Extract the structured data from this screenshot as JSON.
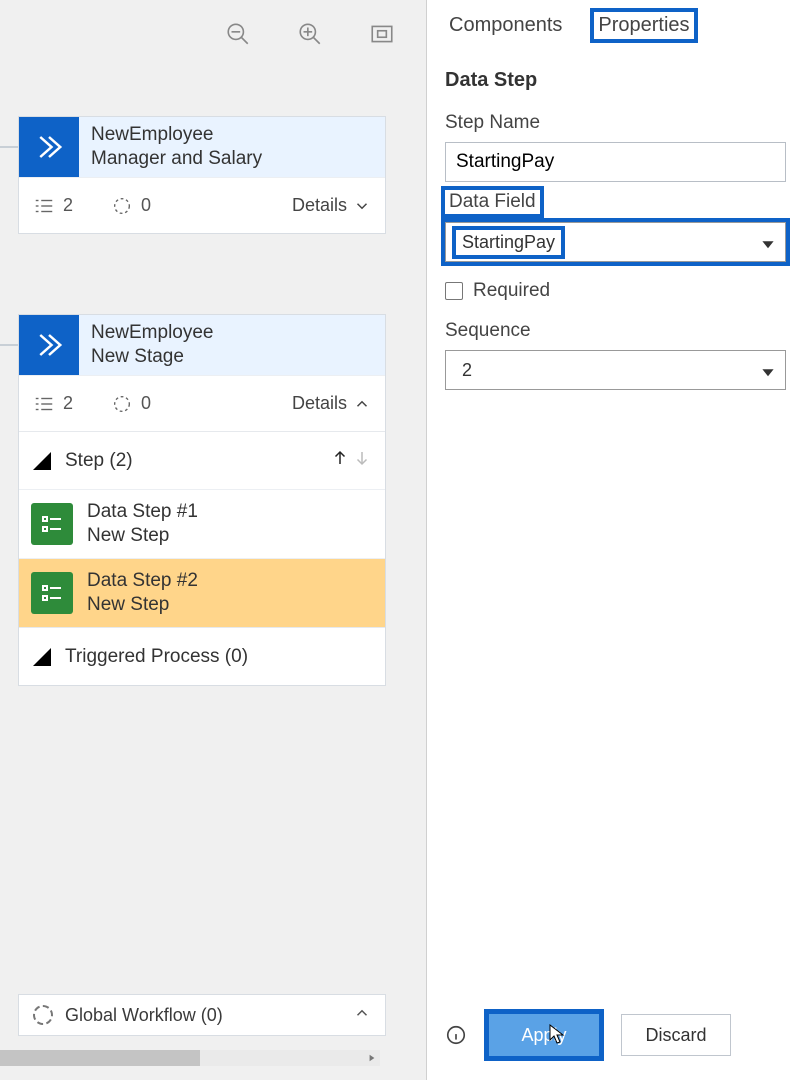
{
  "toolbar": {},
  "stages": [
    {
      "title_line1": "NewEmployee",
      "title_line2": "Manager and Salary",
      "stat1": "2",
      "stat2": "0",
      "details_label": "Details"
    },
    {
      "title_line1": "NewEmployee",
      "title_line2": "New Stage",
      "stat1": "2",
      "stat2": "0",
      "details_label": "Details",
      "step_header": "Step (2)",
      "steps": [
        {
          "line1": "Data Step #1",
          "line2": "New Step"
        },
        {
          "line1": "Data Step #2",
          "line2": "New Step"
        }
      ],
      "triggered": "Triggered Process (0)"
    }
  ],
  "global_workflow": "Global Workflow (0)",
  "tabs": {
    "components": "Components",
    "properties": "Properties"
  },
  "panel": {
    "title": "Data Step",
    "step_name_label": "Step Name",
    "step_name_value": "StartingPay",
    "data_field_label": "Data Field",
    "data_field_value": "StartingPay",
    "required_label": "Required",
    "sequence_label": "Sequence",
    "sequence_value": "2"
  },
  "actions": {
    "apply": "Apply",
    "discard": "Discard"
  }
}
